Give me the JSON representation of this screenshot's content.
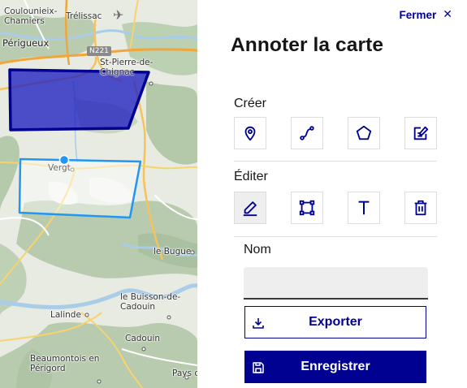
{
  "map": {
    "places": [
      {
        "name": "Coulounieix-\nChamiers",
        "key": "coulounieix"
      },
      {
        "name": "Trélissac",
        "key": "trelissac"
      },
      {
        "name": "Périgueux",
        "key": "perigueux"
      },
      {
        "name": "N221",
        "key": "n221"
      },
      {
        "name": "St-Pierre-de-\nChignac",
        "key": "stpierre"
      },
      {
        "name": "Vergt",
        "key": "vergt"
      },
      {
        "name": "le Bugue",
        "key": "lebugue"
      },
      {
        "name": "le Buisson-de-\nCadouin",
        "key": "lebuisson"
      },
      {
        "name": "Lalinde",
        "key": "lalinde"
      },
      {
        "name": "Cadouin",
        "key": "cadouin"
      },
      {
        "name": "Beaumontois en\nPérigord",
        "key": "beaumontois"
      },
      {
        "name": "Pays c",
        "key": "paysc"
      }
    ],
    "colors": {
      "filled_polygon_fill": "#1f1fbf",
      "filled_polygon_stroke": "#000091",
      "outline_polygon_stroke": "#2196f3",
      "vertex_handle": "#2196f3"
    }
  },
  "panel": {
    "close_label": "Fermer",
    "close_icon": "close-icon",
    "title": "Annoter la carte",
    "create_section": {
      "label": "Créer",
      "tools": [
        {
          "name": "marker-icon",
          "label": "Point"
        },
        {
          "name": "polyline-icon",
          "label": "Ligne"
        },
        {
          "name": "polygon-icon",
          "label": "Polygone"
        },
        {
          "name": "note-icon",
          "label": "Note"
        }
      ]
    },
    "edit_section": {
      "label": "Éditer",
      "tools": [
        {
          "name": "pencil-icon",
          "label": "Modifier",
          "active": true
        },
        {
          "name": "bounding-box-icon",
          "label": "Transformer"
        },
        {
          "name": "text-icon",
          "label": "Texte"
        },
        {
          "name": "trash-icon",
          "label": "Supprimer"
        }
      ]
    },
    "name_field": {
      "label": "Nom",
      "value": "",
      "placeholder": ""
    },
    "export_button": {
      "label": "Exporter",
      "icon": "download-icon"
    },
    "save_button": {
      "label": "Enregistrer",
      "icon": "floppy-disk-icon"
    },
    "accent_color": "#000091"
  }
}
